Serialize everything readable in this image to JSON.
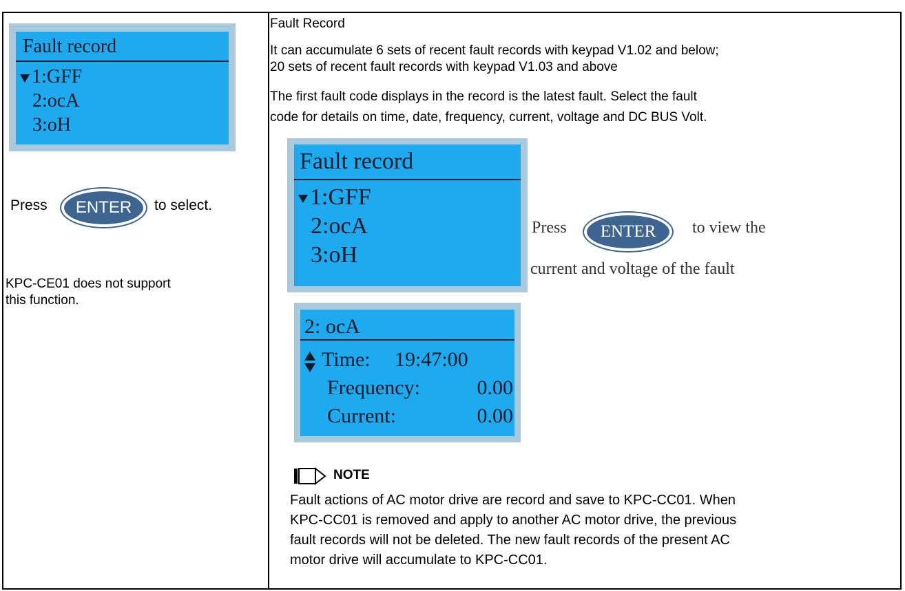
{
  "left": {
    "lcd": {
      "title": "Fault record",
      "items": [
        "1:GFF",
        "2:ocA",
        "3:oH"
      ]
    },
    "press_before": "Press",
    "enter_label": "ENTER",
    "press_after": "to select.",
    "support_note": [
      "KPC-CE01 does not support",
      "this function."
    ]
  },
  "right": {
    "heading": "Fault Record",
    "description": [
      "It can accumulate 6 sets of recent fault records with keypad V1.02 and below;",
      "20 sets of recent fault records with keypad V1.03 and above",
      "The first fault code displays in the record is the latest fault. Select the fault",
      "code for details on time, date, frequency, current, voltage and DC BUS Volt."
    ],
    "lcd1": {
      "title": "Fault record",
      "items": [
        "1:GFF",
        "2:ocA",
        "3:oH"
      ]
    },
    "press_before": "Press",
    "enter_label": "ENTER",
    "press_after": "to view the",
    "press_line2": "current and voltage  of the fault",
    "lcd2": {
      "title": "2: ocA",
      "rows": [
        {
          "label": "Time:",
          "value": "19:47:00"
        },
        {
          "label": "Frequency:",
          "value": "0.00"
        },
        {
          "label": "Current:",
          "value": "0.00"
        }
      ]
    },
    "note_title": "NOTE",
    "note_lines": [
      "Fault actions of AC motor drive are record and save to KPC-CC01. When",
      "KPC-CC01 is removed and apply to another AC motor drive, the previous",
      "fault records will not be deleted. The new fault records of the present AC",
      "motor drive will accumulate to KPC-CC01."
    ]
  },
  "colors": {
    "lcd_bg": "#1eaaee",
    "lcd_frame": "#a9c9dc",
    "lcd_text": "#0a1a2a",
    "enter_button": "#3e6590"
  }
}
